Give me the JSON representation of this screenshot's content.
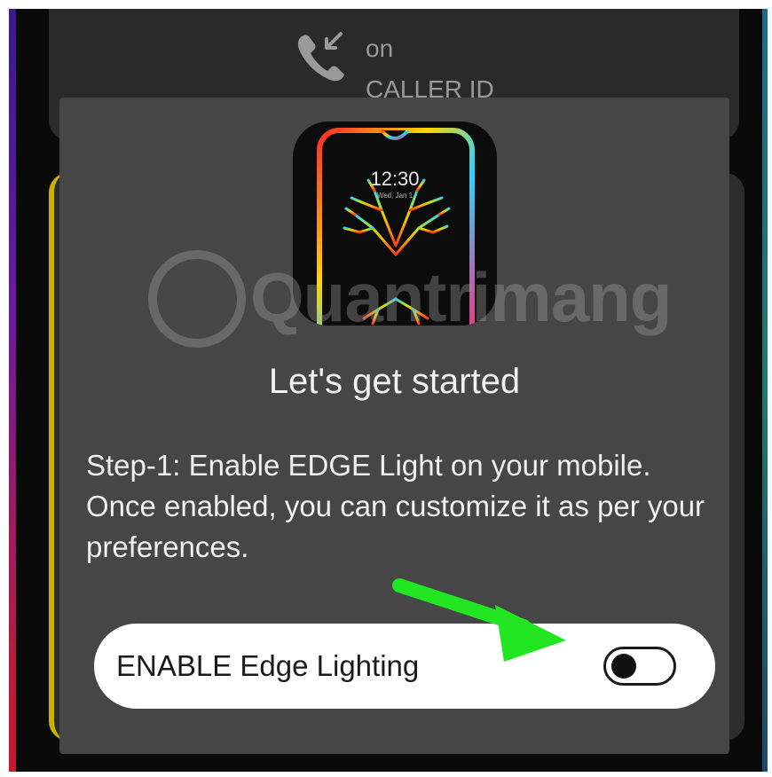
{
  "caller": {
    "line1": "on",
    "line2": "CALLER ID",
    "icon": "incoming-call-icon"
  },
  "preview": {
    "clock": "12:30",
    "date": "Wed, Jan 1"
  },
  "watermark": "Quantrimang",
  "dialog": {
    "title": "Let's get started",
    "body": "Step-1: Enable EDGE Light on your mobile. Once enabled, you can customize it as per your preferences.",
    "toggle_label": "ENABLE Edge Lighting",
    "toggle_on": false
  },
  "colors": {
    "dialog_bg": "#464646",
    "pill_bg": "#ffffff",
    "arrow": "#22e622"
  }
}
